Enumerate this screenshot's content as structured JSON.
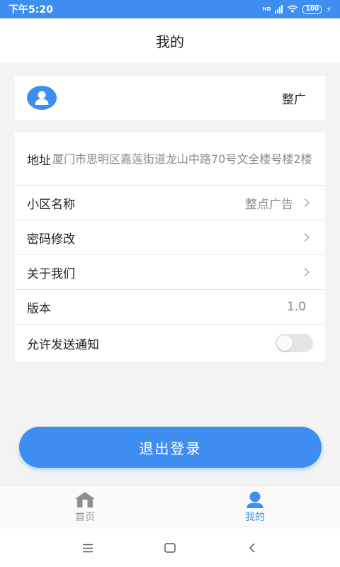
{
  "status_bar": {
    "time": "下午5:20",
    "hd_label": "HD",
    "battery": "100"
  },
  "header": {
    "title": "我的"
  },
  "profile": {
    "username": "整广"
  },
  "settings": {
    "address": {
      "label": "地址",
      "value": "厦门市思明区嘉莲街道龙山中路70号文全楼号楼2楼"
    },
    "community": {
      "label": "小区名称",
      "value": "整点广告"
    },
    "password": {
      "label": "密码修改"
    },
    "about": {
      "label": "关于我们"
    },
    "version": {
      "label": "版本",
      "value": "1.0"
    },
    "notifications": {
      "label": "允许发送通知",
      "enabled": false
    }
  },
  "logout_button": {
    "label": "退出登录"
  },
  "tab_bar": {
    "items": [
      {
        "label": "首页",
        "icon": "home-icon",
        "active": false
      },
      {
        "label": "我的",
        "icon": "user-icon",
        "active": true
      }
    ]
  },
  "colors": {
    "accent": "#3d8ef0",
    "background": "#f3f3f3",
    "toggle_off": "#e4e4e4"
  }
}
